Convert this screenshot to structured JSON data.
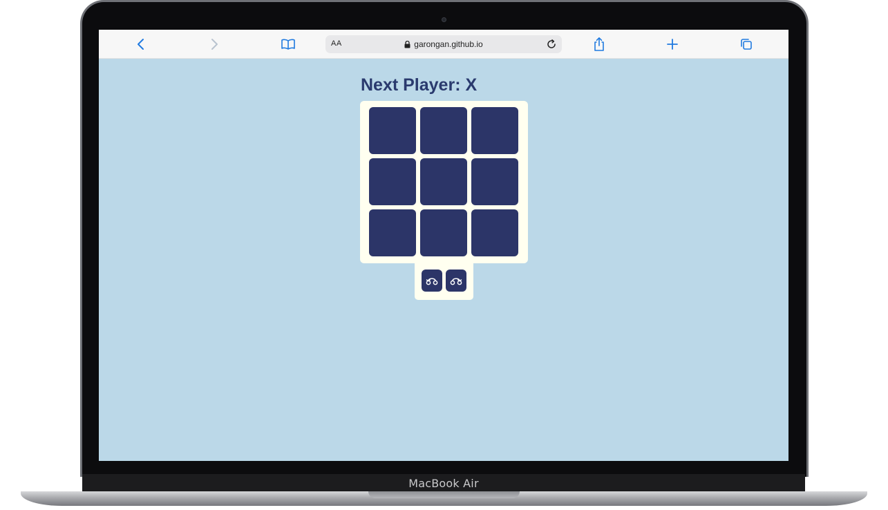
{
  "device": {
    "model_label": "MacBook Air"
  },
  "browser": {
    "text_size_label": "AA",
    "url": "garongan.github.io",
    "icons": {
      "back": "chevron-left-icon",
      "forward": "chevron-right-icon",
      "bookmarks": "book-icon",
      "lock": "lock-icon",
      "reload": "reload-icon",
      "share": "share-icon",
      "new_tab": "plus-icon",
      "tabs": "tabs-icon"
    },
    "accent_color": "#1f7ae0"
  },
  "game": {
    "status": "Next Player: X",
    "cells": [
      "",
      "",
      "",
      "",
      "",
      "",
      "",
      "",
      ""
    ],
    "controls": [
      {
        "icon": "undo-icon"
      },
      {
        "icon": "redo-icon"
      }
    ],
    "colors": {
      "background": "#bbd8e8",
      "panel": "#fffff0",
      "cell": "#2c3568",
      "status_text": "#2a3a6e"
    }
  }
}
